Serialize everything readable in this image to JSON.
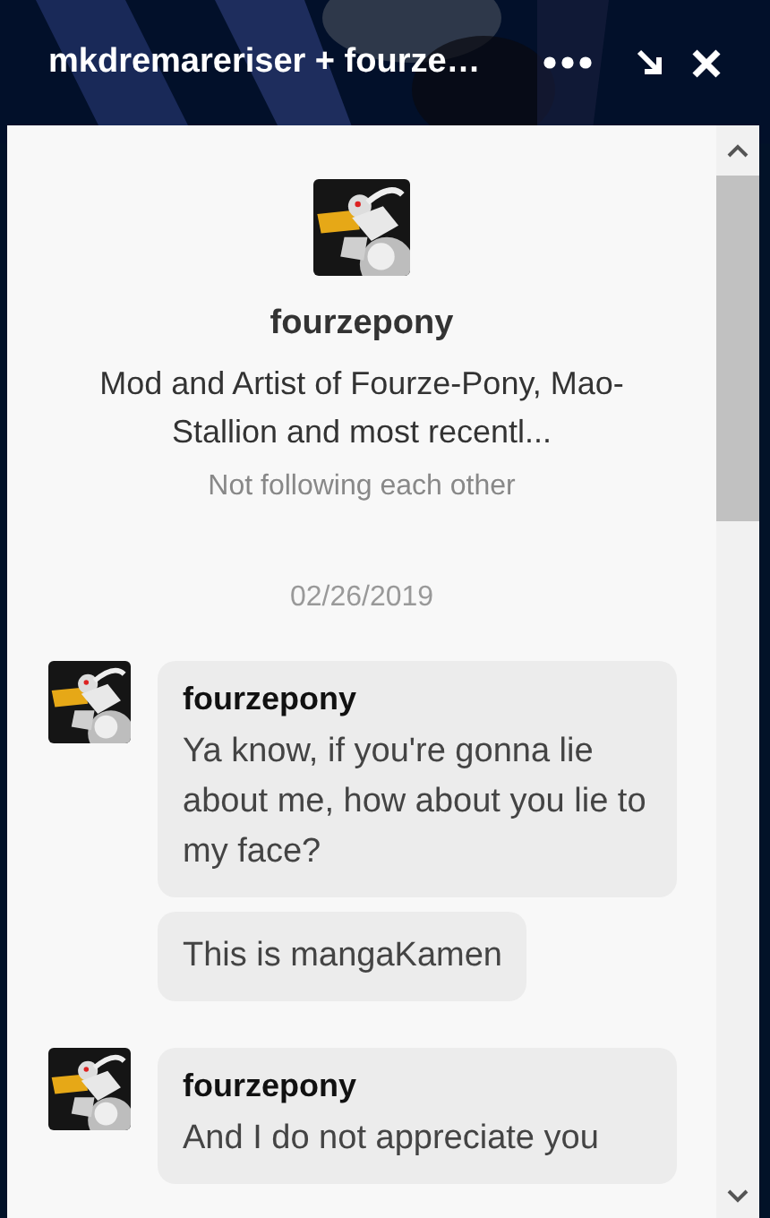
{
  "header": {
    "title": "mkdremareriser + fourze…"
  },
  "profile": {
    "name": "fourzepony",
    "bio": "Mod and Artist of Fourze-Pony, Mao-Stallion and most recentl...",
    "relation": "Not following each other"
  },
  "date": "02/26/2019",
  "messages": [
    {
      "author": "fourzepony",
      "bubbles": [
        "Ya know, if you're gonna lie about me, how about you lie to my face?",
        "This is mangaKamen"
      ]
    },
    {
      "author": "fourzepony",
      "bubbles": [
        "And I do not appreciate you"
      ]
    }
  ]
}
